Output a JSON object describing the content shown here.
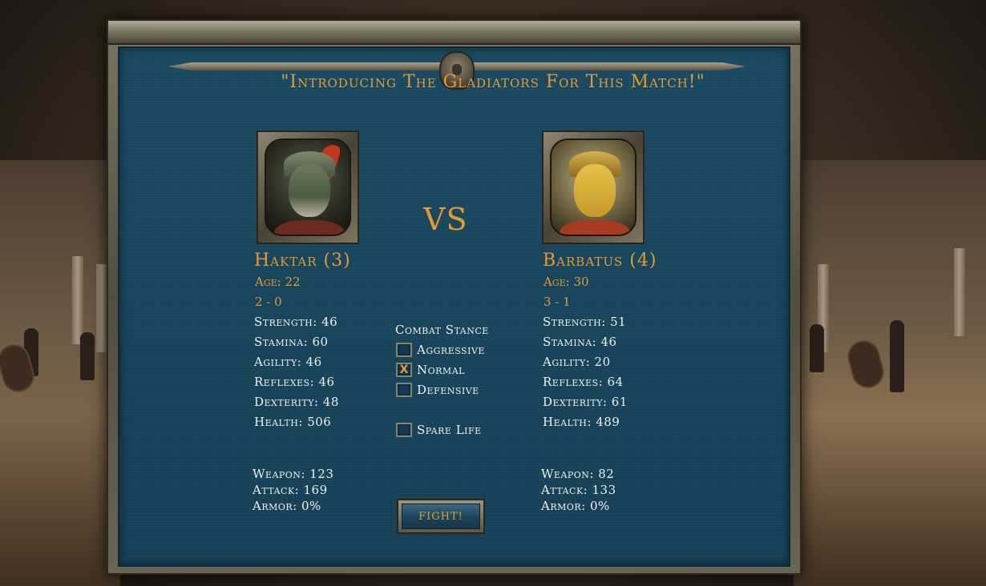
{
  "title": "\"Introducing The Gladiators For This Match!\"",
  "vs_label": "VS",
  "left": {
    "name": "Haktar (3)",
    "age": "Age: 22",
    "record": "2 - 0",
    "stats": {
      "strength": "Strength: 46",
      "stamina": "Stamina: 60",
      "agility": "Agility: 46",
      "reflexes": "Reflexes: 46",
      "dexterity": "Dexterity: 48",
      "health": "Health: 506"
    },
    "gear": {
      "weapon": "Weapon: 123",
      "attack": "Attack: 169",
      "armor": "Armor: 0%"
    }
  },
  "right": {
    "name": "Barbatus (4)",
    "age": "Age: 30",
    "record": "3 - 1",
    "stats": {
      "strength": "Strength: 51",
      "stamina": "Stamina: 46",
      "agility": "Agility: 20",
      "reflexes": "Reflexes: 64",
      "dexterity": "Dexterity: 61",
      "health": "Health: 489"
    },
    "gear": {
      "weapon": "Weapon: 82",
      "attack": "Attack: 133",
      "armor": "Armor: 0%"
    }
  },
  "stance": {
    "title": "Combat Stance",
    "options": [
      {
        "label": "Aggressive",
        "checked": false,
        "mark": ""
      },
      {
        "label": "Normal",
        "checked": true,
        "mark": "X"
      },
      {
        "label": "Defensive",
        "checked": false,
        "mark": ""
      }
    ],
    "spare_life": {
      "label": "Spare Life",
      "checked": false,
      "mark": ""
    }
  },
  "fight_label": "FIGHT!",
  "colors": {
    "accent": "#e39a32",
    "panel": "#17445a",
    "text": "#f2efe6"
  }
}
